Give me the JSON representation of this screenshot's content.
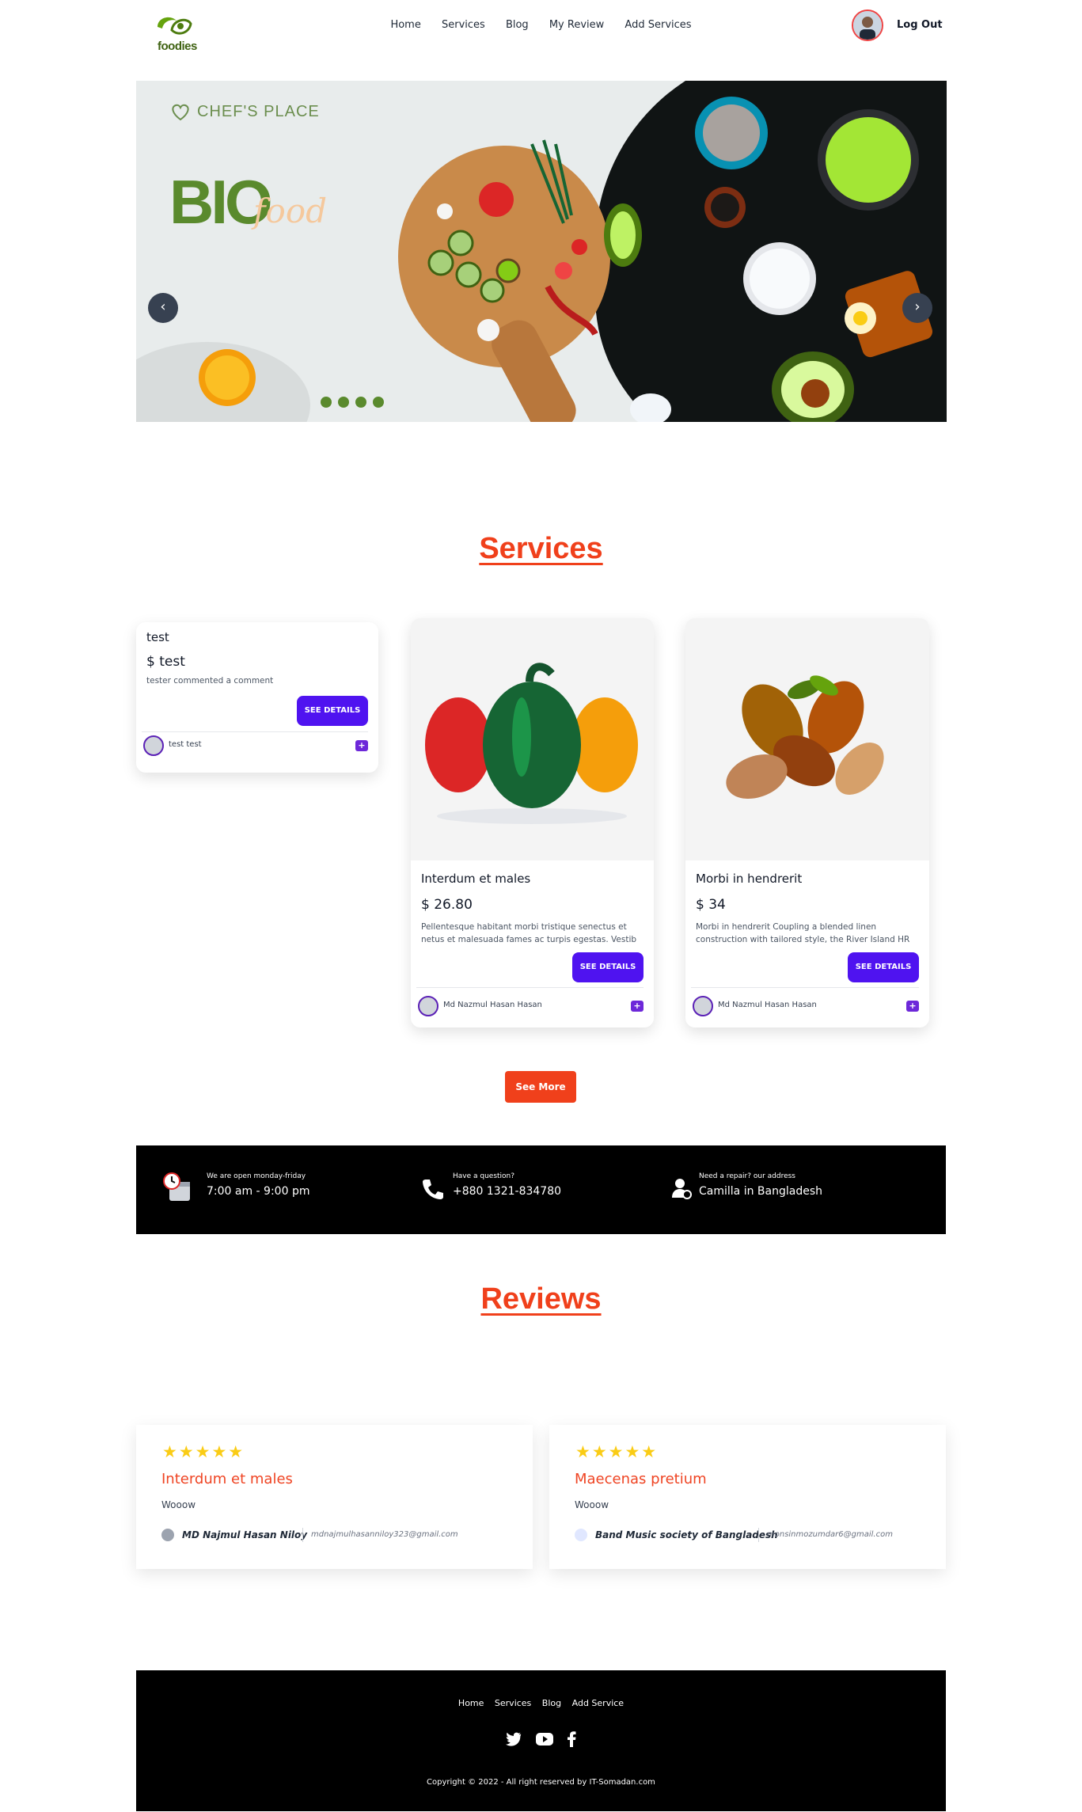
{
  "nav": {
    "logo_text": "foodies",
    "links": [
      "Home",
      "Services",
      "Blog",
      "My Review",
      "Add Services"
    ],
    "logout": "Log Out"
  },
  "hero": {
    "brand": "CHEF'S PLACE",
    "title_bio": "BIO",
    "title_food": "food",
    "prev": "‹",
    "next": "›"
  },
  "services": {
    "title": "Services",
    "cards": [
      {
        "title": "test",
        "price": "$ test",
        "desc": "tester commented a comment",
        "button": "SEE DETAILS",
        "author": "test test"
      },
      {
        "title": "Interdum et males",
        "price": "$ 26.80",
        "desc": "Pellentesque habitant morbi tristique senectus et netus et malesuada fames ac turpis egestas. Vestib",
        "button": "SEE DETAILS",
        "author": "Md Nazmul Hasan Hasan"
      },
      {
        "title": "Morbi in hendrerit",
        "price": "$ 34",
        "desc": "Morbi in hendrerit Coupling a blended linen construction with tailored style, the River Island HR Ja",
        "button": "SEE DETAILS",
        "author": "Md Nazmul Hasan Hasan"
      }
    ],
    "see_more": "See More"
  },
  "info": [
    {
      "small": "We are open monday-friday",
      "big": "7:00 am - 9:00 pm",
      "icon": "calendar-clock-icon"
    },
    {
      "small": "Have a question?",
      "big": "+880 1321-834780",
      "icon": "phone-icon"
    },
    {
      "small": "Need a repair? our address",
      "big": "Camilla in Bangladesh",
      "icon": "user-location-icon"
    }
  ],
  "reviews": {
    "title": "Reviews",
    "items": [
      {
        "stars": "★★★★★",
        "title": "Interdum et males",
        "text": "Wooow",
        "name": "MD Najmul Hasan Niloy",
        "email": "mdnajmulhasanniloy323@gmail.com"
      },
      {
        "stars": "★★★★★",
        "title": "Maecenas pretium",
        "text": "Wooow",
        "name": "Band Music society of Bangladesh",
        "email": "monsinmozumdar6@gmail.com"
      }
    ]
  },
  "footer": {
    "links": [
      "Home",
      "Services",
      "Blog",
      "Add Service"
    ],
    "copyright": "Copyright © 2022 - All right reserved by IT-Somadan.com"
  },
  "colors": {
    "accent": "#f0401b",
    "button": "#4f13f0",
    "brand_green": "#5a8a2d"
  }
}
